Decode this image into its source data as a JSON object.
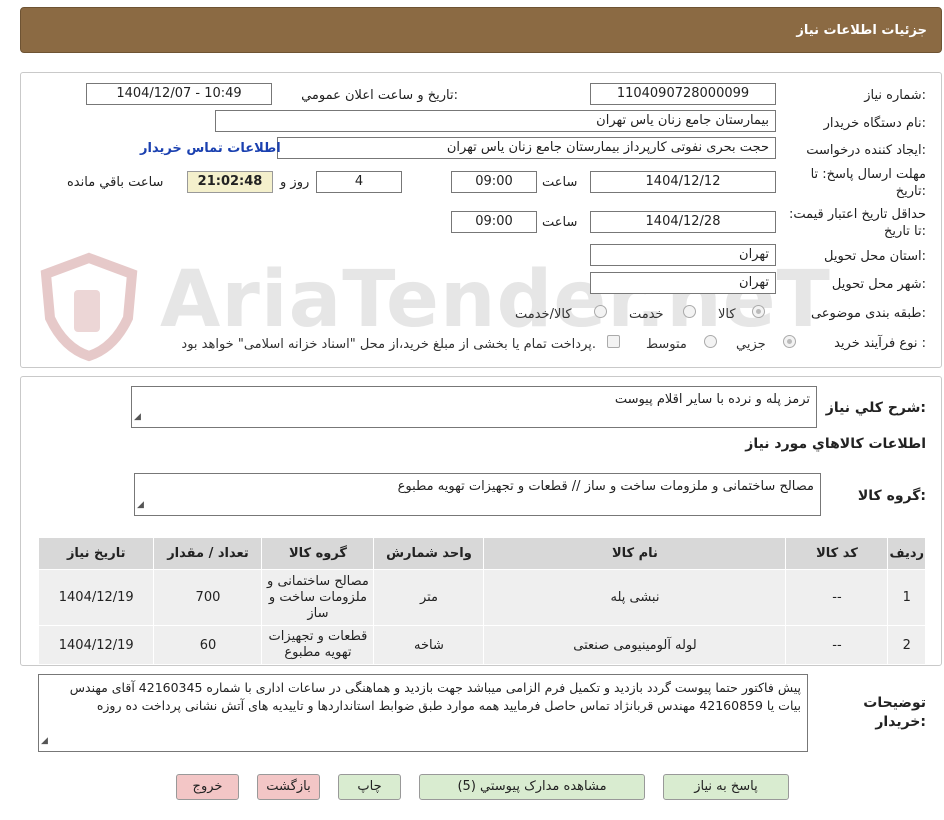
{
  "header": {
    "title": "جزئیات اطلاعات نیاز"
  },
  "info": {
    "need_number_label": "شماره نیاز:",
    "need_number": "1104090728000099",
    "announce_label": "تاریخ و ساعت اعلان عمومي:",
    "announce_value": "1404/12/07 - 10:49",
    "buyer_label": "نام دستگاه خریدار:",
    "buyer_value": "بیمارستان جامع زنان یاس تهران",
    "creator_label": "ایجاد کننده درخواست:",
    "creator_value": "حجت بحری نفوتی کارپرداز بیمارستان جامع زنان یاس تهران",
    "contact_link": "اطلاعات تماس خریدار",
    "deadline_label": "مهلت ارسال پاسخ: تا تاریخ:",
    "deadline_date": "1404/12/12",
    "time_label": "ساعت",
    "deadline_time": "09:00",
    "days_value": "4",
    "days_label": "روز و",
    "remaining_time": "21:02:48",
    "remaining_label": "ساعت باقي مانده",
    "validity_label": "حداقل تاریخ اعتبار قیمت: تا تاریخ:",
    "validity_date": "1404/12/28",
    "validity_time": "09:00",
    "province_label": "استان محل تحویل:",
    "province_value": "تهران",
    "city_label": "شهر محل تحویل:",
    "city_value": "تهران",
    "category_label": "طبقه بندی موضوعی:",
    "category_options": [
      "کالا",
      "خدمت",
      "کالا/خدمت"
    ],
    "process_label": "نوع فرآیند خرید :",
    "process_options": [
      "جزیي",
      "متوسط"
    ],
    "process_note": "پرداخت تمام یا بخشی از مبلغ خرید،از محل \"اسناد خزانه اسلامی\" خواهد بود."
  },
  "watermark": "AriaTender.neT",
  "description": {
    "label": "شرح کلي نیاز:",
    "value": "ترمز پله و نرده با سایر اقلام پیوست"
  },
  "goods_section_title": "اطلاعات کالاهاي مورد نیاز",
  "goods_group": {
    "label": "گروه کالا:",
    "value": "مصالح ساختمانی و ملزومات ساخت و ساز //  قطعات و تجهیزات تهویه مطبوع"
  },
  "table": {
    "headers": [
      "ردیف",
      "کد کالا",
      "نام کالا",
      "واحد شمارش",
      "گروه کالا",
      "تعداد / مقدار",
      "تاریخ نیاز"
    ],
    "rows": [
      [
        "1",
        "--",
        "نبشی پله",
        "متر",
        "مصالح ساختمانی و ملزومات ساخت و ساز",
        "700",
        "1404/12/19"
      ],
      [
        "2",
        "--",
        "لوله آلومینیومی صنعتی",
        "شاخه",
        "قطعات و تجهیزات تهویه مطبوع",
        "60",
        "1404/12/19"
      ]
    ]
  },
  "buyer_notes": {
    "label": "توضیحات خریدار:",
    "value": "پیش فاکتور حتما پیوست گردد بازدید و تکمیل فرم الزامی میباشد جهت بازدید و هماهنگی در ساعات اداری با شماره 42160345 آقای مهندس بیات یا 42160859 مهندس قربانژاد تماس حاصل فرمایید همه موارد طبق ضوابط استانداردها و تاییدیه های آتش نشانی پرداخت ده روزه"
  },
  "buttons": {
    "reply": "پاسخ به نیاز",
    "attachments": "مشاهده مدارک پیوستي (5)",
    "print": "چاپ",
    "back": "بازگشت",
    "exit": "خروج"
  }
}
